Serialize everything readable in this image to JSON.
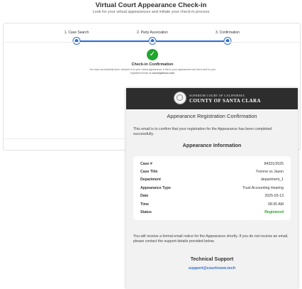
{
  "page": {
    "title": "Virtual Court Appearance Check-in",
    "subtitle": "Look for your virtual appearances and initiate your check-in process"
  },
  "steps": [
    {
      "label": "1. Case Search"
    },
    {
      "label": "2. Party Association"
    },
    {
      "label": "3. Confirmation"
    }
  ],
  "confirmation": {
    "title": "Check-in Confirmation",
    "text": "You have successfully been checked in to your virtual appearance. A link to your appearance has been sent to your registered email at ",
    "email": "cucu@yahooo.com"
  },
  "email": {
    "court_line1": "SUPERIOR COURT OF CALIFORNIA",
    "court_line2": "COUNTY OF SANTA CLARA",
    "title": "Appearance Registration Confirmation",
    "intro": "This email is to confirm that your registration for the Appearance has been completed successfully.",
    "info_title": "Appearance Information",
    "rows": [
      {
        "label": "Case #",
        "value": "84331/2025"
      },
      {
        "label": "Case Title",
        "value": "Yvonne vs Jason"
      },
      {
        "label": "Department",
        "value": "department_1"
      },
      {
        "label": "Appearance Type",
        "value": "Trust Accounting Hearing"
      },
      {
        "label": "Date",
        "value": "2025-03-13"
      },
      {
        "label": "Time",
        "value": "08:30 AM"
      },
      {
        "label": "Status",
        "value": "Registered"
      }
    ],
    "notice": "You will receive a formal email notice for the Appearance shortly. If you do not receive an email, please contact the support details provided below.",
    "support_title": "Technical Support",
    "support_email": "support@courtroom.tech"
  },
  "colors": {
    "accent": "#2d6fd0",
    "success": "#21a52e",
    "status_registered": "#2aa22a",
    "email_header": "#2d2d2d"
  },
  "icons": {
    "confirm": "check-circle-icon",
    "seal": "court-seal-icon"
  }
}
